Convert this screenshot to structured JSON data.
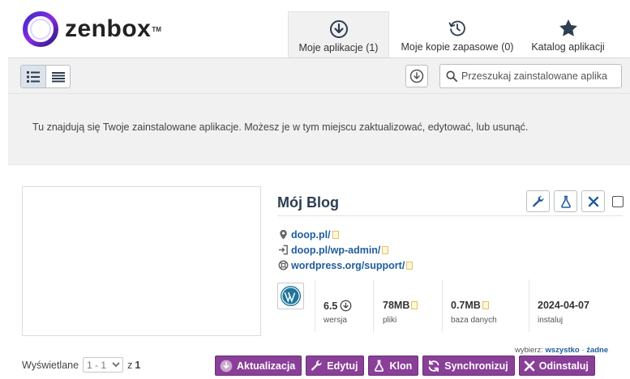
{
  "brand": {
    "name": "zenbox",
    "tm": "TM"
  },
  "tabs": [
    {
      "label": "Moje aplikacje (1)",
      "icon": "download-circle-icon",
      "active": true
    },
    {
      "label": "Moje kopie zapasowe (0)",
      "icon": "history-clock-icon",
      "active": false
    },
    {
      "label": "Katalog aplikacji",
      "icon": "star-icon",
      "active": false
    }
  ],
  "toolbar": {
    "search_placeholder": "Przeszukaj zainstalowane aplika"
  },
  "info": {
    "text": "Tu znajdują się Twoje zainstalowane aplikacje. Możesz je w tym miejscu zaktualizować, edytować, lub usunąć."
  },
  "app": {
    "title": "Mój Blog",
    "links": {
      "site": "doop.pl/",
      "admin": "doop.pl/wp-admin/",
      "support": "wordpress.org/support/"
    },
    "stats": {
      "version": {
        "value": "6.5",
        "label": "wersja"
      },
      "files": {
        "value": "78MB",
        "label": "pliki"
      },
      "database": {
        "value": "0.7MB",
        "label": "baza danych"
      },
      "installed": {
        "value": "2024-04-07",
        "label": "instaluj"
      }
    }
  },
  "select": {
    "label": "wybierz:",
    "all": "wszystko",
    "dot": "·",
    "none": "żadne"
  },
  "pager": {
    "label": "Wyświetlane",
    "range": "1 - 1",
    "of": "z",
    "total": "1"
  },
  "actions": {
    "update": "Aktualizacja",
    "edit": "Edytuj",
    "clone": "Klon",
    "sync": "Synchronizuj",
    "uninstall": "Odinstaluj"
  },
  "colors": {
    "accent_purple": "#8a3f98",
    "link_blue": "#1f5d9c",
    "title_navy": "#2c3e50",
    "band_gray": "#f1f1f1"
  }
}
